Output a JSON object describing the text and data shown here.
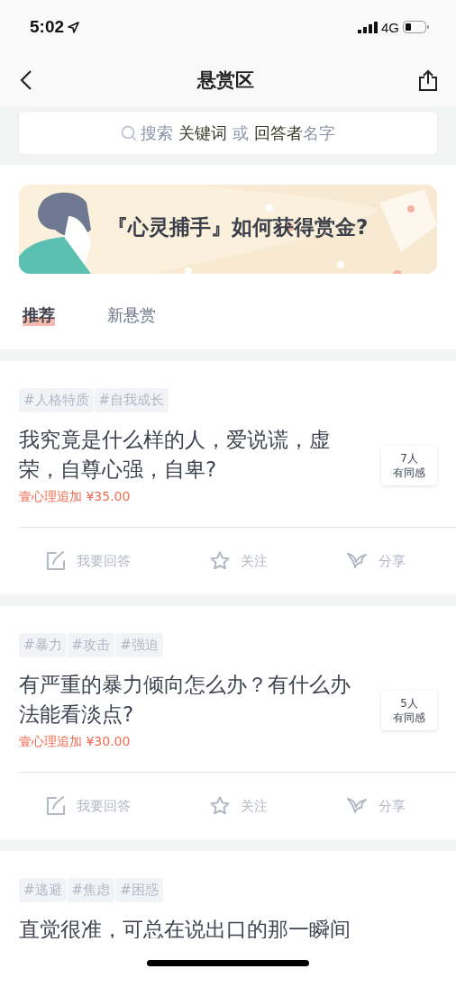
{
  "status_bar": {
    "time": "5:02",
    "network": "4G"
  },
  "nav": {
    "title": "悬赏区"
  },
  "search": {
    "placeholder": "搜索 **关键词** 或 **回答者**名字"
  },
  "banner": {
    "kind": "picture",
    "text": "『心灵捕手』如何获得赏金?"
  },
  "tabs": [
    {
      "label": "推荐",
      "selected": true
    },
    {
      "label": "新悬赏",
      "selected": false
    }
  ],
  "questions": [
    {
      "tags": [
        "#人格特质",
        "#自我成长"
      ],
      "title": "我究竟是什么样的人，爱说谎，虚荣，自尊心强，自卑?",
      "reward": "壹心理追加 ¥35.00",
      "empathy_count": "7人",
      "empathy_label": "有同感",
      "actions": [
        "我要回答",
        "关注",
        "分享"
      ]
    },
    {
      "tags": [
        "#暴力",
        "#攻击",
        "#强迫"
      ],
      "title": "有严重的暴力倾向怎么办？有什么办法能看淡点?",
      "reward": "壹心理追加 ¥30.00",
      "empathy_count": "5人",
      "empathy_label": "有同感",
      "actions": [
        "我要回答",
        "关注",
        "分享"
      ]
    },
    {
      "tags": [
        "#逃避",
        "#焦虑",
        "#困惑"
      ],
      "title": "直觉很准，可总在说出口的那一瞬间"
    }
  ]
}
